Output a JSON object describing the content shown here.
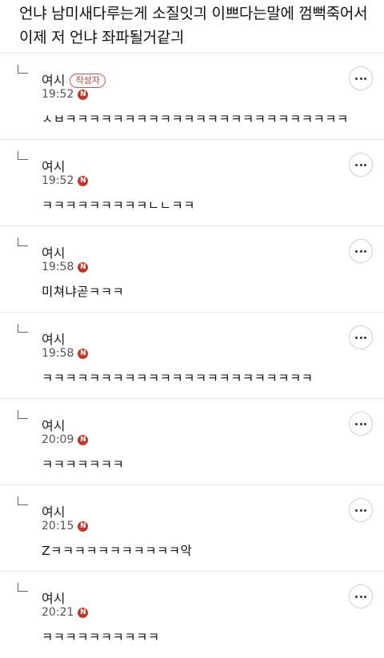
{
  "post": {
    "text": "언냐 남미새다루는게 소질잇긔 이쁘다는말에 껌뻑죽어서 이제 저 언냐 좌파될거같긔"
  },
  "comments": [
    {
      "author": "여시",
      "badge": "작성자",
      "time": "19:52",
      "new_label": "N",
      "text": "ㅅㅂㅋㅋㅋㅋㅋㅋㅋㅋㅋㅋㅋㅋㅋㅋㅋㅋㅋㅋㅋㅋㅋㅋㅋㅋ"
    },
    {
      "author": "여시",
      "badge": "",
      "time": "19:52",
      "new_label": "N",
      "text": "ㅋㅋㅋㅋㅋㅋㅋㅋㅋㄴㄴㅋㅋ"
    },
    {
      "author": "여시",
      "badge": "",
      "time": "19:58",
      "new_label": "N",
      "text": "미쳐냐곧ㅋㅋㅋ"
    },
    {
      "author": "여시",
      "badge": "",
      "time": "19:58",
      "new_label": "N",
      "text": "ㅋㅋㅋㅋㅋㅋㅋㅋㅋㅋㅋㅋㅋㅋㅋㅋㅋㅋㅋㅋㅋㅋㅋ"
    },
    {
      "author": "여시",
      "badge": "",
      "time": "20:09",
      "new_label": "N",
      "text": "ㅋㅋㅋㅋㅋㅋㅋ"
    },
    {
      "author": "여시",
      "badge": "",
      "time": "20:15",
      "new_label": "N",
      "text": "Zㅋㅋㅋㅋㅋㅋㅋㅋㅋㅋㅋ악"
    },
    {
      "author": "여시",
      "badge": "",
      "time": "20:21",
      "new_label": "N",
      "text": "ㅋㅋㅋㅋㅋㅋㅋㅋㅋㅋ"
    }
  ]
}
